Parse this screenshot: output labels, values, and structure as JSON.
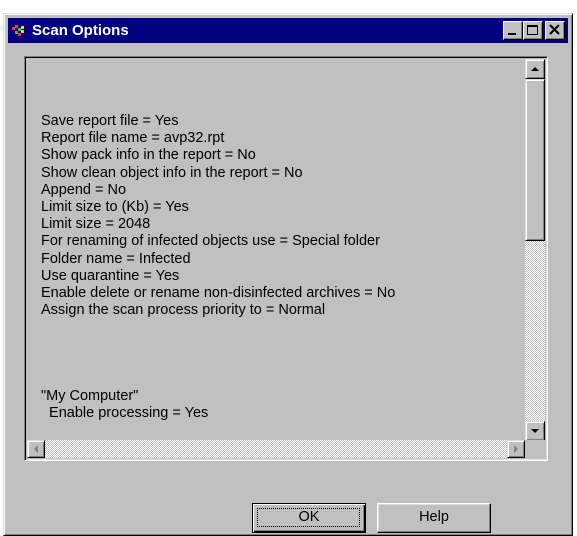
{
  "window": {
    "title": "Scan Options",
    "icon": "kaspersky-app-icon"
  },
  "titlebar_buttons": {
    "minimize_icon": "minimize-icon",
    "maximize_icon": "maximize-icon",
    "close_icon": "close-icon"
  },
  "report": {
    "lines": [
      "Save report file = Yes",
      "Report file name = avp32.rpt",
      "Show pack info in the report = No",
      "Show clean object info in the report = No",
      "Append = No",
      "Limit size to (Kb) = Yes",
      "Limit size = 2048",
      "For renaming of infected objects use = Special folder",
      "Folder name = Infected",
      "Use quarantine = Yes",
      "Enable delete or rename non-disinfected archives = No",
      "Assign the scan process priority to = Normal",
      "",
      "",
      "",
      "",
      "\"My Computer\"",
      "  Enable processing = Yes"
    ]
  },
  "scrollbars": {
    "up_icon": "arrow-up-icon",
    "down_icon": "arrow-down-icon",
    "left_icon": "arrow-left-icon",
    "right_icon": "arrow-right-icon"
  },
  "buttons": {
    "ok_label": "OK",
    "help_label": "Help"
  }
}
